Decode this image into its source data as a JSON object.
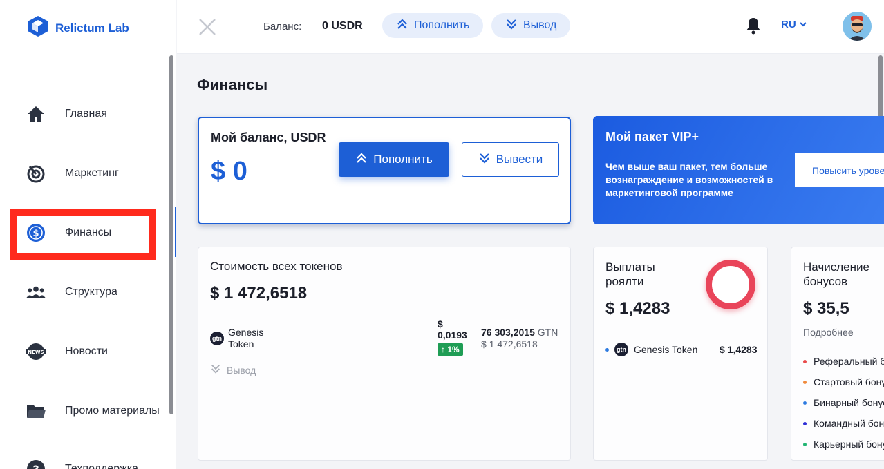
{
  "brand": {
    "name": "Relictum Lab"
  },
  "sidebar": {
    "items": [
      {
        "label": "Главная",
        "icon": "home-icon"
      },
      {
        "label": "Маркетинг",
        "icon": "target-icon"
      },
      {
        "label": "Финансы",
        "icon": "dollar-circle-icon",
        "active": true
      },
      {
        "label": "Структура",
        "icon": "users-icon"
      },
      {
        "label": "Новости",
        "icon": "news-globe-icon"
      },
      {
        "label": "Промо материалы",
        "icon": "folder-icon"
      },
      {
        "label": "Техподдержка",
        "icon": "help-icon"
      }
    ]
  },
  "header": {
    "balance_label": "Баланс:",
    "balance_value": "0 USDR",
    "topup_label": "Пополнить",
    "withdraw_label": "Вывод",
    "lang": "RU"
  },
  "page": {
    "title": "Финансы"
  },
  "balance_card": {
    "title": "Мой баланс, USDR",
    "amount": "$ 0",
    "topup_label": "Пополнить",
    "withdraw_label": "Вывести"
  },
  "vip_card": {
    "title": "Мой пакет VIP+",
    "description": "Чем выше ваш пакет, тем больше вознаграждение и возможностей в маркетинговой программе",
    "button_label": "Повысить уровень"
  },
  "tokens_card": {
    "title": "Стоимость всех токенов",
    "total": "$ 1 472,6518",
    "token": {
      "icon_text": "gtn",
      "name_line1": "Genesis",
      "name_line2": "Token",
      "price_currency": "$",
      "price": "0,0193",
      "change": "↑ 1%",
      "amount": "76 303,2015",
      "amount_unit": "GTN",
      "amount_usd": "$ 1 472,6518",
      "withdraw_label": "Вывод"
    }
  },
  "royalty_card": {
    "title_line1": "Выплаты",
    "title_line2": "роялти",
    "total": "$ 1,4283",
    "item_name": "Genesis Token",
    "item_value": "$ 1,4283",
    "ring_color": "#e9455a"
  },
  "bonus_card": {
    "title_line1": "Начисление",
    "title_line2": "бонусов",
    "total": "$ 35,5",
    "more_label": "Подробнее",
    "items": [
      {
        "label": "Реферальный бонус",
        "color": "#e94a4a"
      },
      {
        "label": "Стартовый бонус",
        "color": "#f08a3c"
      },
      {
        "label": "Бинарный бонус",
        "color": "#2d7be0"
      },
      {
        "label": "Командный бонус",
        "color": "#2f2fd6"
      },
      {
        "label": "Карьерный бонус",
        "color": "#22b573"
      }
    ]
  },
  "colors": {
    "accent": "#1d5fd6",
    "highlight": "#ff2a1d",
    "positive": "#1f9d55"
  }
}
